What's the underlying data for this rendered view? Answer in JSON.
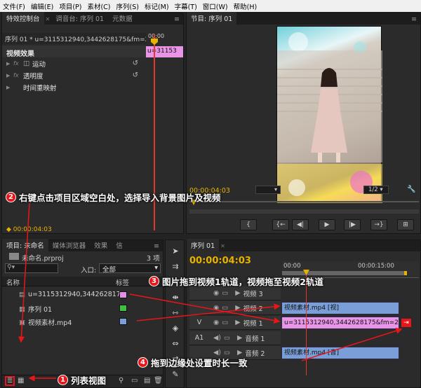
{
  "menu": [
    "文件(F)",
    "编辑(E)",
    "项目(P)",
    "素材(C)",
    "序列(S)",
    "标记(M)",
    "字幕(T)",
    "窗口(W)",
    "帮助(H)"
  ],
  "effects_panel": {
    "tabs": [
      "特效控制台",
      "调音台: 序列 01",
      "元数据"
    ],
    "menu_glyph": "≡",
    "sequence_label": "序列 01 * u=3115312940,3442628175&fm=2...",
    "mini_timecode": "00:00",
    "clip_label": "u=31153",
    "section": "视频效果",
    "effects": [
      {
        "tag": "fx",
        "name": "运动"
      },
      {
        "tag": "fx",
        "name": "透明度"
      },
      {
        "tag": "",
        "name": "时间重映射"
      }
    ],
    "timecode": "00:00:04:03"
  },
  "program_monitor": {
    "tab": "节目: 序列 01",
    "timecode": "00:00:04:03",
    "quality": "1/2",
    "controls": [
      "{",
      "{←",
      "◀|",
      "▶",
      "|▶",
      "→}",
      "⊞"
    ]
  },
  "project_panel": {
    "tabs": [
      "项目: 未命名",
      "媒体浏览器",
      "效果",
      "信"
    ],
    "project_file": "未命名.prproj",
    "item_count": "3 项",
    "search_placeholder": "",
    "inlet_label": "入口:",
    "inlet_value": "全部",
    "columns": [
      "名称",
      "标签"
    ],
    "items": [
      {
        "name": "u=3115312940,3442628175",
        "color": "#e58ce8"
      },
      {
        "name": "序列 01",
        "color": "#3cc33c"
      },
      {
        "name": "视频素材.mp4",
        "color": "#7aa0d8"
      }
    ]
  },
  "timeline": {
    "tab": "序列 01",
    "timecode": "00:00:04:03",
    "ruler": [
      "00:00",
      "00:00:15:00"
    ],
    "tracks": [
      {
        "name": "视频 3",
        "label": ""
      },
      {
        "name": "视频 2",
        "label": ""
      },
      {
        "name": "视频 1",
        "label": "V"
      },
      {
        "name": "音频 1",
        "label": "A1"
      },
      {
        "name": "音频 2",
        "label": ""
      }
    ],
    "clips": {
      "video2": "视频素材.mp4 [视]",
      "video1": "u=3115312940,3442628175&fm=214&gp=",
      "audio2": "视频素材.mp4 [音]"
    }
  },
  "annotations": [
    {
      "num": "1",
      "text": "列表视图"
    },
    {
      "num": "2",
      "text": "右键点击项目区域空白处，选择导入背景图片及视频"
    },
    {
      "num": "3",
      "text": "图片拖到视频1轨道，视频拖至视频2轨道"
    },
    {
      "num": "4",
      "text": "拖到边缘处设置时长一致"
    }
  ],
  "colors": {
    "accent": "#e8b200",
    "annotation_red": "#e8161a",
    "clip_blue": "#7a9fd8",
    "clip_pink": "#e58ce8"
  }
}
